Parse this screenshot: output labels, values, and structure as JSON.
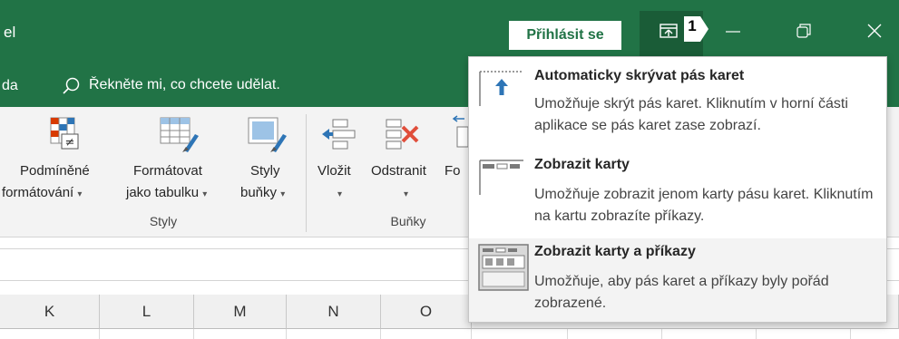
{
  "titlebar": {
    "app_title_fragment": "el",
    "signin_label": "Přihlásit se",
    "callout_number": "1",
    "bg_color": "#217346"
  },
  "tellme": {
    "tab_fragment": "da",
    "text": "Řekněte mi, co chcete udělat."
  },
  "ribbon": {
    "styles_group": {
      "label": "Styly",
      "buttons": [
        {
          "line1": "Podmíněné",
          "line2": "formátování",
          "icon": "conditional-formatting-icon"
        },
        {
          "line1": "Formátovat",
          "line2": "jako tabulku",
          "icon": "format-as-table-icon"
        },
        {
          "line1": "Styly",
          "line2": "buňky",
          "icon": "cell-styles-icon"
        }
      ]
    },
    "cells_group": {
      "label": "Buňky",
      "buttons": [
        {
          "line1": "Vložit",
          "icon": "insert-cells-icon"
        },
        {
          "line1": "Odstranit",
          "icon": "delete-cells-icon"
        },
        {
          "line1": "Fo",
          "icon": "format-cells-icon"
        }
      ]
    }
  },
  "sheet": {
    "columns": [
      "K",
      "L",
      "M",
      "N",
      "O"
    ]
  },
  "menu": {
    "items": [
      {
        "title": "Automaticky skrývat pás karet",
        "desc": "Umožňuje skrýt pás karet. Kliknutím v horní části aplikace se pás karet zase zobrazí.",
        "icon": "auto-hide-ribbon-icon"
      },
      {
        "title": "Zobrazit karty",
        "desc": "Umožňuje zobrazit jenom karty pásu karet. Kliknutím na kartu zobrazíte příkazy.",
        "icon": "show-tabs-icon"
      },
      {
        "title": "Zobrazit karty a příkazy",
        "desc": "Umožňuje, aby pás karet a příkazy byly pořád zobrazené.",
        "icon": "show-tabs-and-commands-icon"
      }
    ]
  }
}
